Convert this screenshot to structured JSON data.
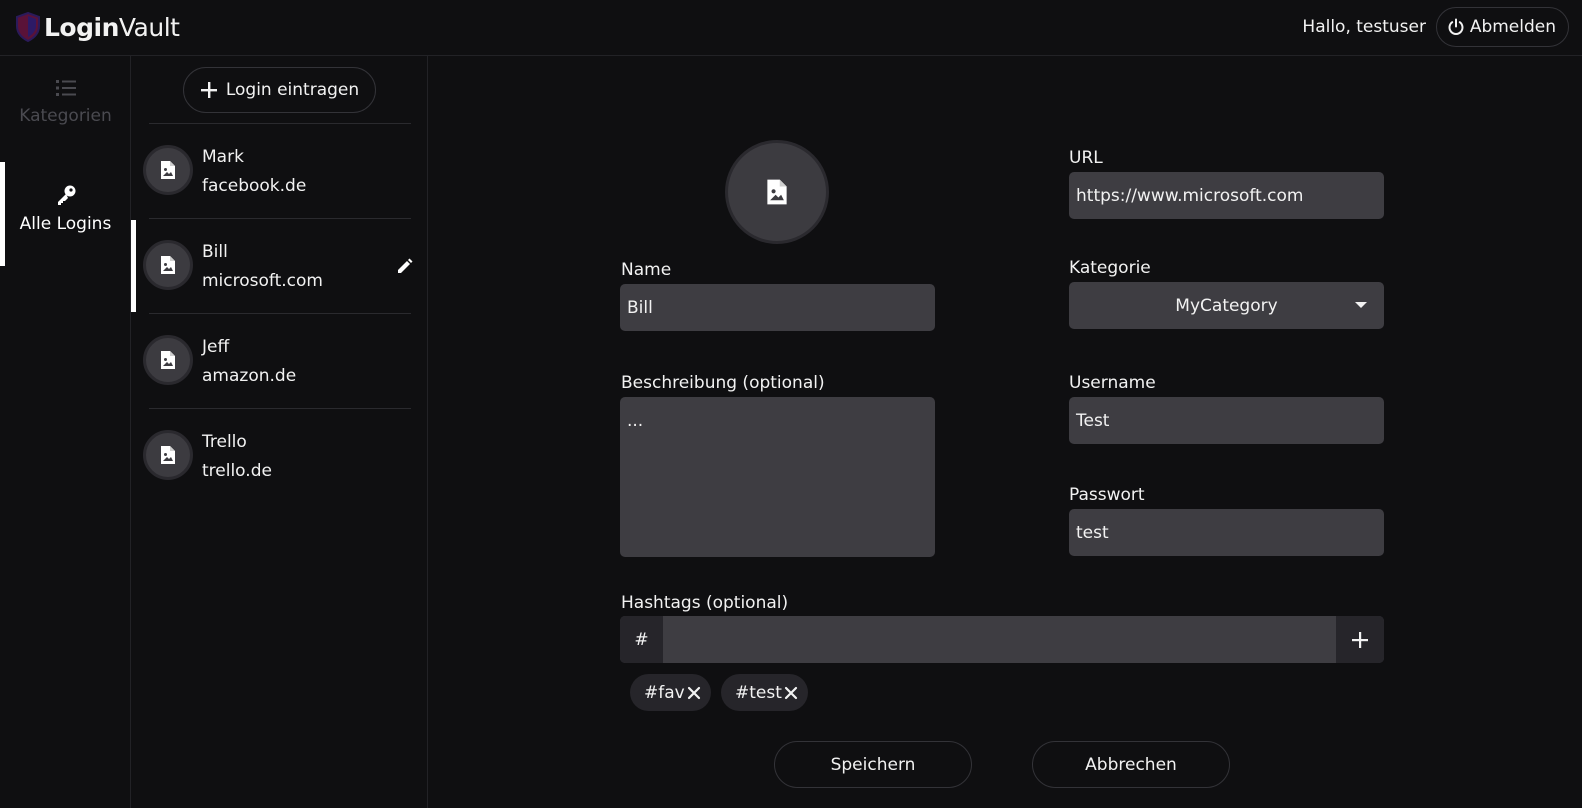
{
  "header": {
    "brand_bold": "Login",
    "brand_light": "Vault",
    "greeting": "Hallo, testuser",
    "logout_label": "Abmelden"
  },
  "rail": {
    "categories_label": "Kategorien",
    "all_logins_label": "Alle Logins"
  },
  "list": {
    "add_label": "Login eintragen",
    "items": [
      {
        "name": "Mark",
        "domain": "facebook.de"
      },
      {
        "name": "Bill",
        "domain": "microsoft.com"
      },
      {
        "name": "Jeff",
        "domain": "amazon.de"
      },
      {
        "name": "Trello",
        "domain": "trello.de"
      }
    ]
  },
  "form": {
    "name_label": "Name",
    "name_value": "Bill",
    "description_label": "Beschreibung (optional)",
    "description_value": "...",
    "url_label": "URL",
    "url_value": "https://www.microsoft.com",
    "category_label": "Kategorie",
    "category_value": "MyCategory",
    "username_label": "Username",
    "username_value": "Test",
    "password_label": "Passwort",
    "password_value": "test",
    "hashtags_label": "Hashtags (optional)",
    "hash_prefix": "#",
    "tags": [
      "#fav",
      "#test"
    ],
    "save_label": "Speichern",
    "cancel_label": "Abbrechen"
  },
  "colors": {
    "background": "#0f0f11",
    "field": "#3e3d42",
    "accent_shield": "#6b1a4a"
  }
}
